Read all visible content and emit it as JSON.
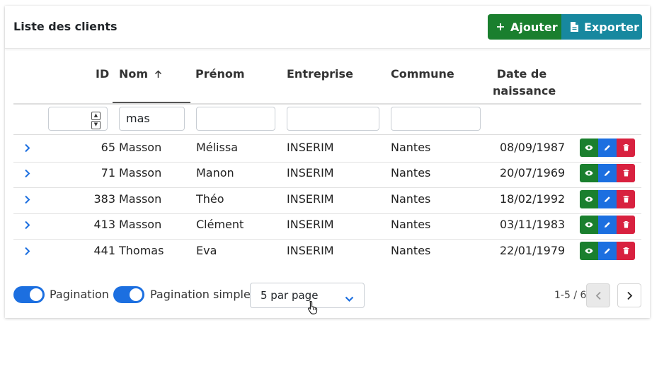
{
  "header": {
    "title": "Liste des clients",
    "add_label": "Ajouter",
    "export_label": "Exporter"
  },
  "columns": {
    "id": "ID",
    "nom": "Nom",
    "prenom": "Prénom",
    "entreprise": "Entreprise",
    "commune": "Commune",
    "naissance_line1": "Date de",
    "naissance_line2": "naissance"
  },
  "filters": {
    "id": "",
    "nom": "mas",
    "prenom": "",
    "entreprise": "",
    "commune": ""
  },
  "rows": [
    {
      "id": "65",
      "nom": "Masson",
      "prenom": "Mélissa",
      "entreprise": "INSERIM",
      "commune": "Nantes",
      "naissance": "08/09/1987"
    },
    {
      "id": "71",
      "nom": "Masson",
      "prenom": "Manon",
      "entreprise": "INSERIM",
      "commune": "Nantes",
      "naissance": "20/07/1969"
    },
    {
      "id": "383",
      "nom": "Masson",
      "prenom": "Théo",
      "entreprise": "INSERIM",
      "commune": "Nantes",
      "naissance": "18/02/1992"
    },
    {
      "id": "413",
      "nom": "Masson",
      "prenom": "Clément",
      "entreprise": "INSERIM",
      "commune": "Nantes",
      "naissance": "03/11/1983"
    },
    {
      "id": "441",
      "nom": "Thomas",
      "prenom": "Eva",
      "entreprise": "INSERIM",
      "commune": "Nantes",
      "naissance": "22/01/1979"
    }
  ],
  "footer": {
    "pagination_label": "Pagination",
    "simple_pagination_label": "Pagination simple",
    "per_page_value": "5 par page",
    "page_count": "1-5 / 6"
  },
  "colors": {
    "add": "#1a7f2e",
    "export": "#17889f",
    "view": "#1a7f2e",
    "edit": "#1c6fe0",
    "delete": "#d8213f",
    "toggle_on": "#1c6fe0"
  },
  "icons": {
    "add": "plus-icon",
    "export": "file-icon",
    "sort": "arrow-up-icon",
    "expand": "chevron-right-icon",
    "view": "eye-icon",
    "edit": "pencil-icon",
    "delete": "trash-icon",
    "select": "chevron-down-icon",
    "prev": "chevron-left-icon",
    "next": "chevron-right-icon"
  }
}
